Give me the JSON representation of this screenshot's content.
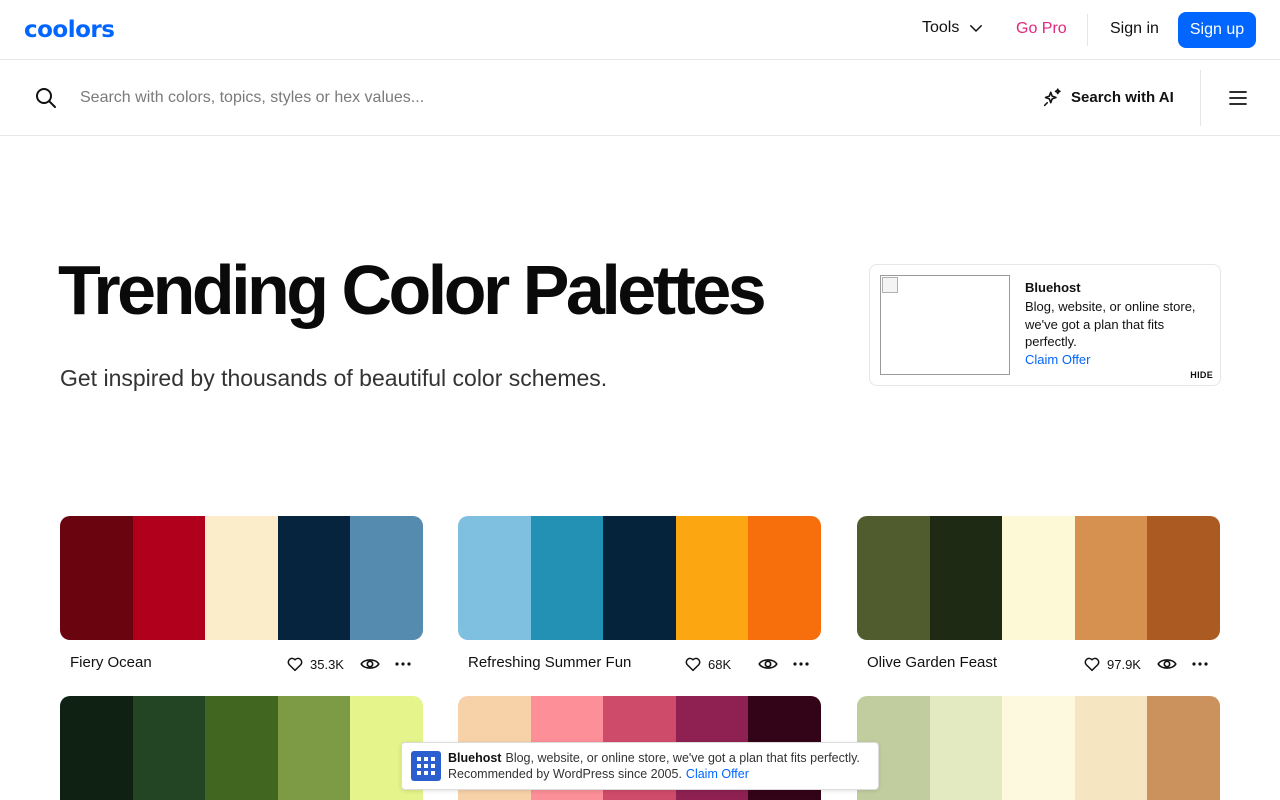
{
  "nav": {
    "logo": "coolors",
    "tools_label": "Tools",
    "gopro_label": "Go Pro",
    "signin_label": "Sign in",
    "signup_label": "Sign up",
    "accent_color": "#0066ff",
    "gopro_color": "#e0287c"
  },
  "search": {
    "placeholder": "Search with colors, topics, styles or hex values...",
    "ai_label": "Search with AI"
  },
  "hero": {
    "title": "Trending Color Palettes",
    "subtitle": "Get inspired by thousands of beautiful color schemes."
  },
  "ad": {
    "brand": "Bluehost",
    "text": "Blog, website, or online store, we've got a plan that fits perfectly.",
    "link": "Claim Offer",
    "hide_label": "HIDE"
  },
  "palettes": [
    {
      "name": "Fiery Ocean",
      "likes": "35.3K",
      "colors": [
        "#6a040f",
        "#b1001c",
        "#fbecca",
        "#06243d",
        "#568bb0"
      ]
    },
    {
      "name": "Refreshing Summer Fun",
      "likes": "68K",
      "colors": [
        "#7fbfe0",
        "#2291b3",
        "#05233a",
        "#fca612",
        "#f76e0c"
      ]
    },
    {
      "name": "Olive Garden Feast",
      "likes": "97.9K",
      "colors": [
        "#505c2e",
        "#1f2a15",
        "#fdf9d7",
        "#d69050",
        "#ab5a22"
      ]
    },
    {
      "name": "",
      "likes": "",
      "colors": [
        "#0f2113",
        "#244524",
        "#40661f",
        "#7c9b44",
        "#e6f48c"
      ]
    },
    {
      "name": "",
      "likes": "",
      "colors": [
        "#f7d2a9",
        "#fc8f98",
        "#cf4b6a",
        "#8e2152",
        "#330417"
      ]
    },
    {
      "name": "",
      "likes": "",
      "colors": [
        "#c2cd9f",
        "#e3e9c0",
        "#fdf9de",
        "#f6e5c1",
        "#cc925e"
      ]
    }
  ],
  "banner": {
    "brand": "Bluehost",
    "text": "Blog, website, or online store, we've got a plan that fits perfectly. Recommended by WordPress since 2005.",
    "link": "Claim Offer"
  }
}
